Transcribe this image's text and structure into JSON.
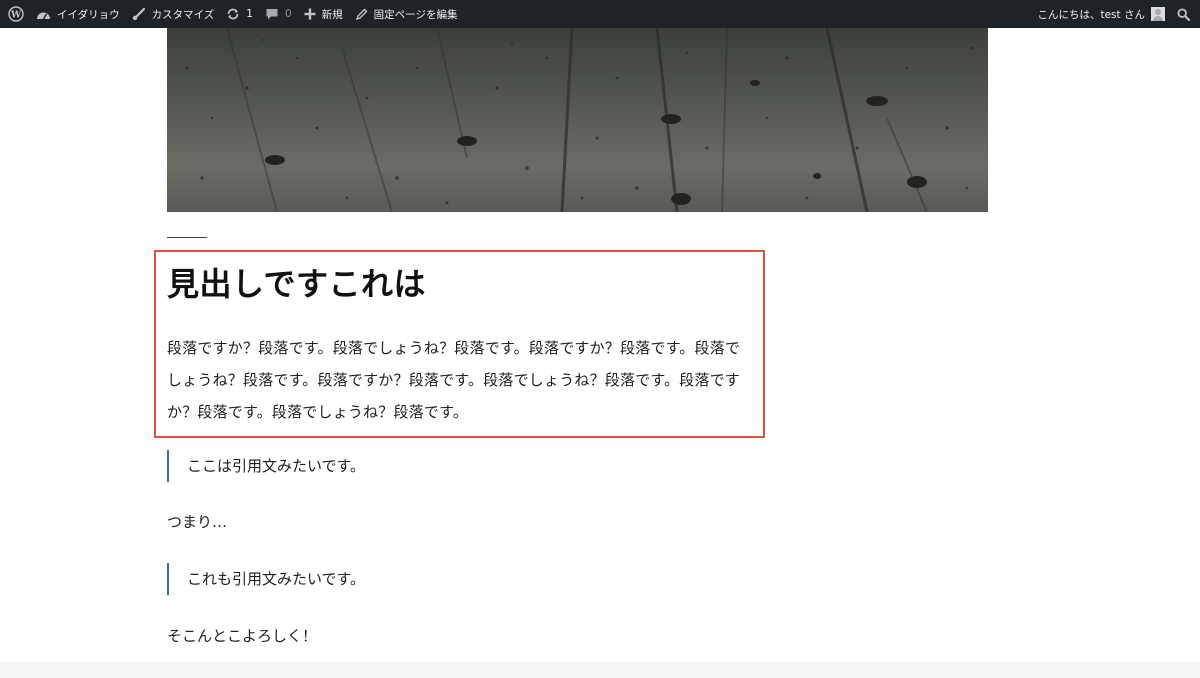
{
  "adminbar": {
    "site_name": "イイダリョウ",
    "customize": "カスタマイズ",
    "updates_count": "1",
    "comments_count": "0",
    "new_label": "新規",
    "edit_page_label": "固定ページを編集",
    "greeting": "こんにちは、test さん",
    "colors": {
      "background": "#1d2327",
      "text": "#f0f0f1"
    }
  },
  "article": {
    "heading": "見出しですこれは",
    "paragraph": "段落ですか？段落です。段落でしょうね？段落です。段落ですか？段落です。段落でしょうね？段落です。段落ですか？段落です。段落でしょうね？段落です。段落ですか？段落です。段落でしょうね？段落です。",
    "quote1": "ここは引用文みたいです。",
    "text1": "つまり…",
    "quote2": "これも引用文みたいです。",
    "text2": "そこんとこよろしく！"
  },
  "colors": {
    "focus_outline": "#d9533e",
    "quote_border": "#3e6f9c"
  }
}
